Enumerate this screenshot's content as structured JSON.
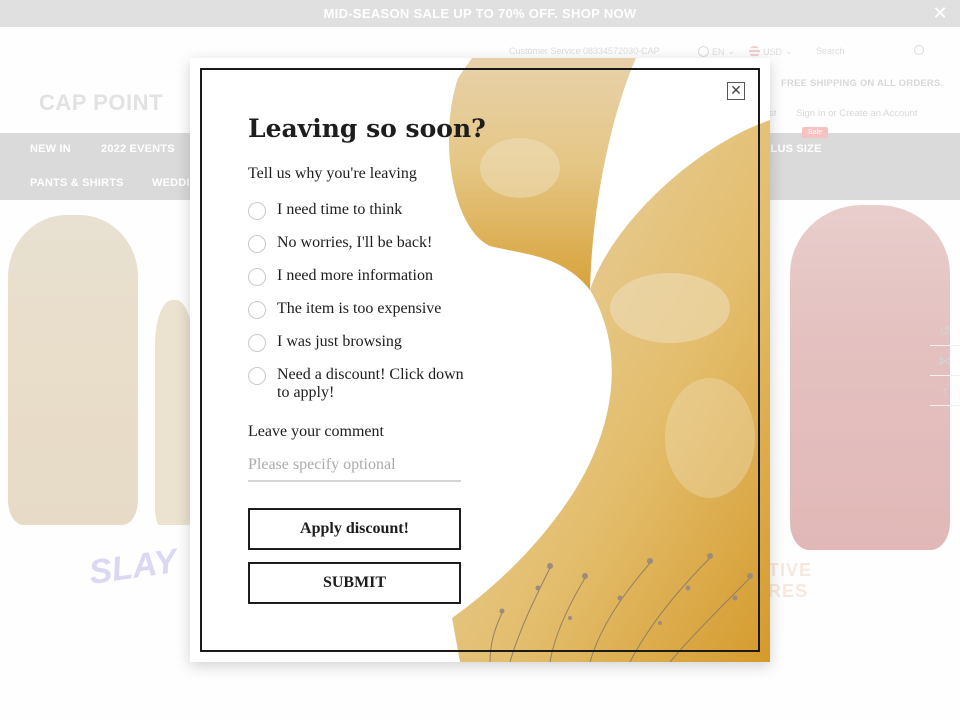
{
  "announcement": {
    "text": "MID-SEASON SALE UP TO 70% OFF. SHOP NOW",
    "close_glyph": "✕"
  },
  "topbar": {
    "customer_service": "Customer Service 08334572030-CAP",
    "language": "EN",
    "currency": "USD",
    "search_placeholder": "Search"
  },
  "header": {
    "logo": "CAP POINT",
    "free_shipping": "FREE SHIPPING ON ALL ORDERS.",
    "account_text": "Sign In or Create an Account",
    "wishlist_fragment": "st"
  },
  "nav": {
    "row1": [
      "NEW IN",
      "2022 EVENTS"
    ],
    "row1_right": "PLUS SIZE",
    "row2": [
      "PANTS & SHIRTS",
      "WEDDI"
    ],
    "sale_badge": "Sale"
  },
  "promo": {
    "left_script": "SLAY",
    "right_script": "TIVE\nRES"
  },
  "side_tools": [
    {
      "icon": "history-icon",
      "glyph": "↺"
    },
    {
      "icon": "share-icon",
      "glyph": "⋈"
    },
    {
      "icon": "arrow-up-icon",
      "glyph": "↑"
    }
  ],
  "modal": {
    "title": "Leaving so soon?",
    "subtitle": "Tell us why you're leaving",
    "reasons": [
      {
        "label": "I need time to think"
      },
      {
        "label": "No worries, I'll be back!"
      },
      {
        "label": "I need more information"
      },
      {
        "label": "The item is too expensive"
      },
      {
        "label": "I was just browsing"
      },
      {
        "label": "Need a discount! Click down to apply!"
      }
    ],
    "comment_label": "Leave your comment",
    "comment_placeholder": "Please specify optional",
    "comment_value": "",
    "apply_button": "Apply discount!",
    "submit_button": "SUBMIT",
    "close_glyph": "✕"
  },
  "colors": {
    "announcement_bg": "#cfcfcf",
    "nav_bg": "#c6c6c6",
    "modal_border": "#1a1a1a",
    "art_gold": "#e2b75c"
  }
}
